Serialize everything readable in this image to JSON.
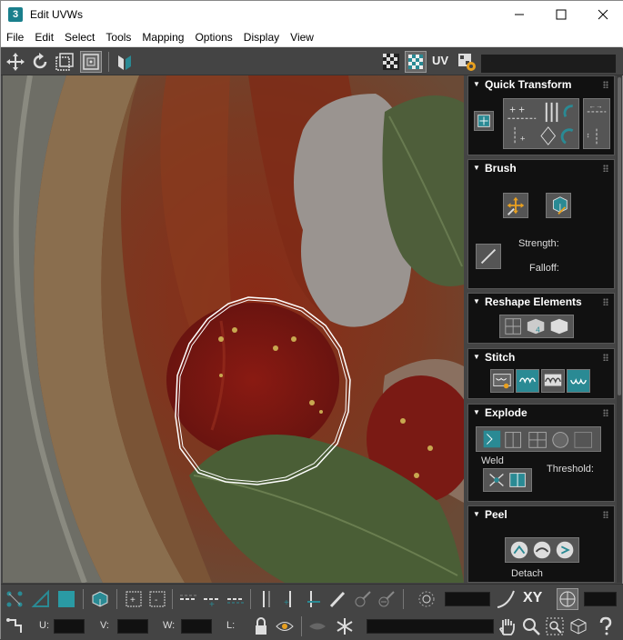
{
  "window": {
    "title": "Edit UVWs",
    "app_icon_text": "3",
    "controls": [
      "minimize",
      "maximize",
      "close"
    ]
  },
  "menu": {
    "items": [
      "File",
      "Edit",
      "Select",
      "Tools",
      "Mapping",
      "Options",
      "Display",
      "View"
    ]
  },
  "top_toolbar": {
    "uv_label": "UV",
    "icons": [
      "move-icon",
      "rotate-icon",
      "scale-icon",
      "freeform-icon",
      "mirror-icon",
      "checker-icon",
      "checker-pattern-icon",
      "uv-settings-icon"
    ]
  },
  "panel": {
    "quick_transform": {
      "title": "Quick Transform"
    },
    "brush": {
      "title": "Brush",
      "strength_label": "Strength:",
      "falloff_label": "Falloff:"
    },
    "reshape": {
      "title": "Reshape Elements"
    },
    "stitch": {
      "title": "Stitch"
    },
    "explode": {
      "title": "Explode",
      "weld_label": "Weld",
      "threshold_label": "Threshold:"
    },
    "peel": {
      "title": "Peel",
      "detach_label": "Detach"
    }
  },
  "bottom_toolbar": {
    "xy_label": "XY",
    "u_label": "U:",
    "v_label": "V:",
    "w_label": "W:",
    "l_label": "L:"
  },
  "colors": {
    "accent_teal": "#2a8a94",
    "panel_bg": "#111111",
    "toolbar_bg": "#444444"
  }
}
